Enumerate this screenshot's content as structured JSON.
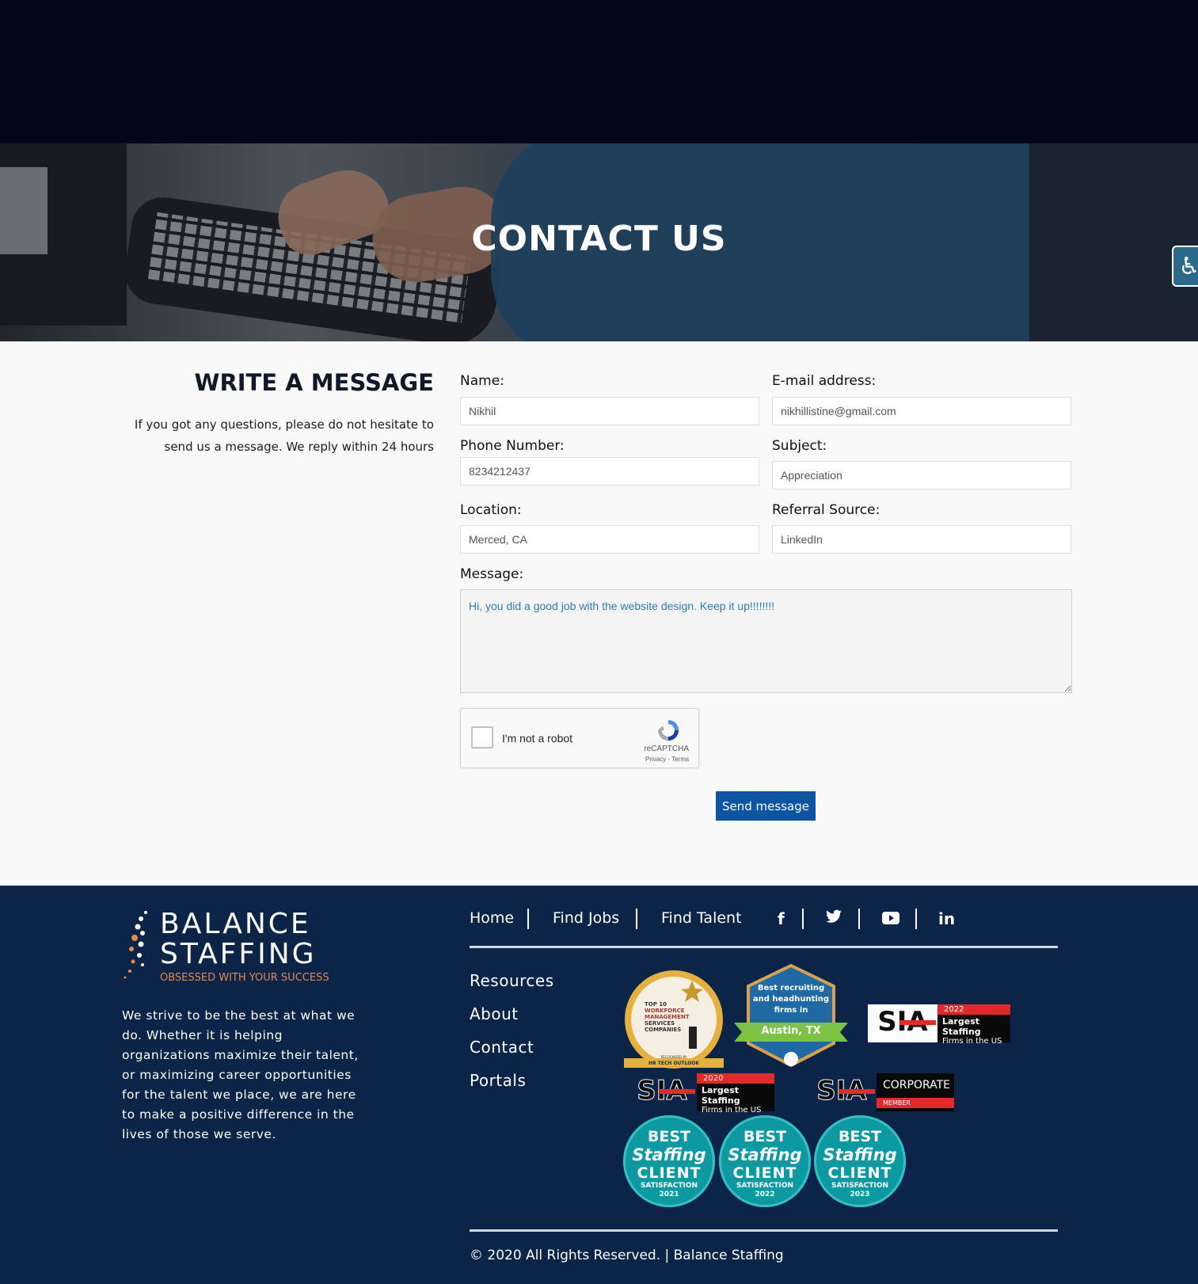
{
  "hero": {
    "title": "CONTACT US"
  },
  "accessibility": {
    "icon": "wheelchair-icon",
    "glyph": "♿"
  },
  "intro": {
    "heading": "WRITE A MESSAGE",
    "text": "If you got any questions, please do not hesitate to send us a message. We reply within 24 hours"
  },
  "form": {
    "name": {
      "label": "Name:",
      "value": "Nikhil"
    },
    "email": {
      "label": "E-mail address:",
      "value": "nikhillistine@gmail.com"
    },
    "phone": {
      "label": "Phone Number:",
      "value": "8234212437"
    },
    "subject": {
      "label": "Subject:",
      "value": "Appreciation"
    },
    "location": {
      "label": "Location:",
      "value": "Merced, CA"
    },
    "referral": {
      "label": "Referral Source:",
      "value": "LinkedIn"
    },
    "message": {
      "label": "Message:",
      "value": "Hi, you did a good job with the website design. Keep it up!!!!!!!!"
    },
    "captcha": {
      "label": "I'm not a robot",
      "brand": "reCAPTCHA",
      "terms": "Privacy - Terms"
    },
    "submit_label": "Send message"
  },
  "footer": {
    "logo": {
      "line1": "BALANCE",
      "line2": "STAFFING",
      "tagline": "OBSESSED WITH YOUR SUCCESS"
    },
    "description": "We strive to be the best at what we do. Whether it is helping organizations maximize their talent, or maximizing career opportunities for the talent we place, we are here to make a positive difference in the lives of those we serve.",
    "nav": [
      "Home",
      "Find Jobs",
      "Find Talent"
    ],
    "social": [
      {
        "icon": "facebook-icon",
        "glyph": "f"
      },
      {
        "icon": "twitter-icon",
        "glyph": "🐦"
      },
      {
        "icon": "youtube-icon",
        "glyph": "▶"
      },
      {
        "icon": "linkedin-icon",
        "glyph": "in"
      }
    ],
    "links": [
      "Resources",
      "About",
      "Contact",
      "Portals"
    ],
    "badges": {
      "hrtech": {
        "l1": "TOP 10",
        "l2": "WORKFORCE",
        "l3": "MANAGEMENT",
        "l4": "SERVICES",
        "l5": "COMPANIES",
        "l6": "RECOGNIZED BY",
        "l7": "HR TECH OUTLOOK"
      },
      "austin": {
        "l1": "Best recruiting",
        "l2": "and headhunting",
        "l3": "firms in",
        "city": "Austin, TX"
      },
      "sia2022": {
        "mark": "SIA",
        "year": "2022",
        "l1": "Largest Staffing",
        "l2": "Firms in the US"
      },
      "sia2020": {
        "mark": "SIA",
        "year": "2020",
        "l1": "Largest Staffing",
        "l2": "Firms in the US"
      },
      "siacorp": {
        "mark": "SIA",
        "l1": "CORPORATE",
        "l2": "MEMBER"
      },
      "best": [
        {
          "t1": "BEST",
          "t2": "Staffing",
          "t3": "CLIENT",
          "t4": "SATISFACTION",
          "year": "2021"
        },
        {
          "t1": "BEST",
          "t2": "Staffing",
          "t3": "CLIENT",
          "t4": "SATISFACTION",
          "year": "2022"
        },
        {
          "t1": "BEST",
          "t2": "Staffing",
          "t3": "CLIENT",
          "t4": "SATISFACTION",
          "year": "2023"
        }
      ]
    },
    "copyright": "© 2020 All Rights Reserved. | Balance Staffing"
  },
  "colors": {
    "topbar": "#03051a",
    "footer": "#0b2447",
    "button": "#0b55a3",
    "accent": "#e58a4f",
    "sia_red": "#e3292a",
    "best_teal": "#0b9aa2"
  }
}
